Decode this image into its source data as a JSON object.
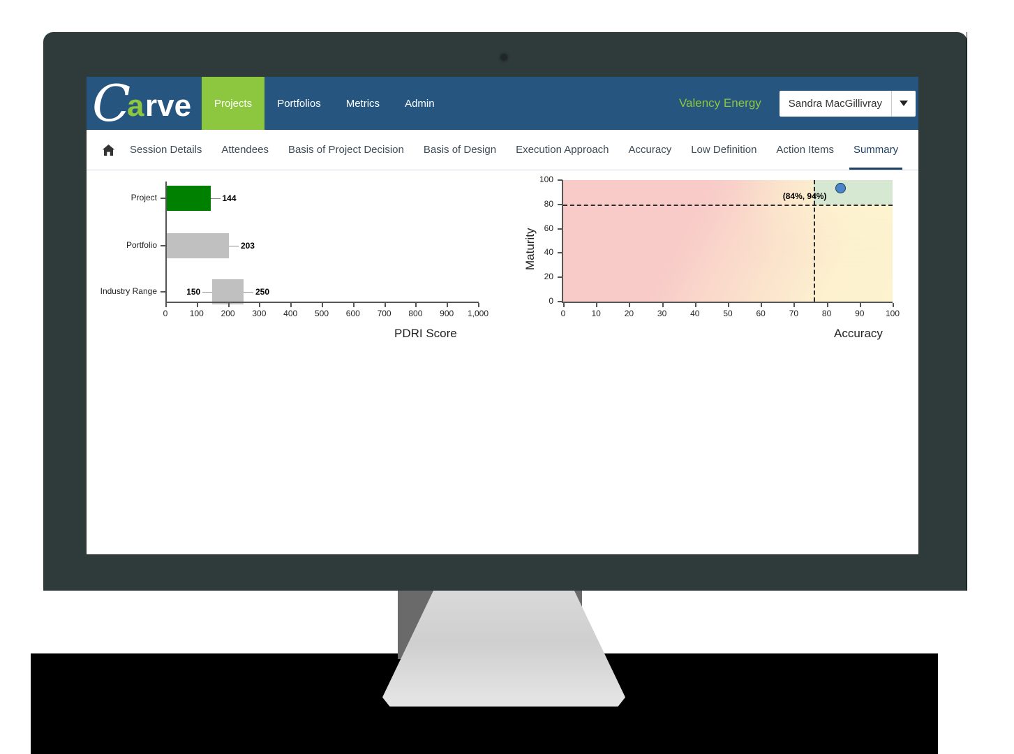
{
  "app": {
    "brand": {
      "letter_c": "C",
      "letter_a": "a",
      "rest": "rve",
      "full": "Carve"
    },
    "nav_items": [
      {
        "label": "Projects",
        "active": true
      },
      {
        "label": "Portfolios",
        "active": false
      },
      {
        "label": "Metrics",
        "active": false
      },
      {
        "label": "Admin",
        "active": false
      }
    ],
    "org_name": "Valency Energy",
    "user_name": "Sandra MacGillivray",
    "caret_icon": "chevron-down-icon",
    "home_icon": "home-icon",
    "colors": {
      "nav_blue": "#26567f",
      "accent_green": "#8dc63f",
      "bar_green": "#008000",
      "bar_gray": "#c0c0c0",
      "heat_red": "#f8cbc8",
      "heat_green": "#d6e8d1",
      "heat_yellow": "#fdf3cf",
      "point_blue": "#4a86c8",
      "bezel": "#2f3a3b"
    }
  },
  "tabs": [
    {
      "label": "Session Details",
      "active": false
    },
    {
      "label": "Attendees",
      "active": false
    },
    {
      "label": "Basis of Project Decision",
      "active": false
    },
    {
      "label": "Basis of Design",
      "active": false
    },
    {
      "label": "Execution Approach",
      "active": false
    },
    {
      "label": "Accuracy",
      "active": false
    },
    {
      "label": "Low Definition",
      "active": false
    },
    {
      "label": "Action Items",
      "active": false
    },
    {
      "label": "Summary",
      "active": true
    }
  ],
  "chart_data": [
    {
      "type": "bar",
      "orientation": "horizontal",
      "title": "",
      "xlabel": "PDRI Score",
      "ylabel": "",
      "xlim": [
        0,
        1000
      ],
      "grid": false,
      "categories": [
        "Project",
        "Portfolio",
        "Industry Range"
      ],
      "tick_labels": [
        "0",
        "100",
        "200",
        "300",
        "400",
        "500",
        "600",
        "700",
        "800",
        "900",
        "1,000"
      ],
      "ticks": [
        0,
        100,
        200,
        300,
        400,
        500,
        600,
        700,
        800,
        900,
        1000
      ],
      "bars": [
        {
          "category": "Project",
          "start": 0,
          "end": 144,
          "value": 144,
          "label": "144",
          "color": "#008000"
        },
        {
          "category": "Portfolio",
          "start": 0,
          "end": 203,
          "value": 203,
          "label": "203",
          "color": "#c0c0c0"
        },
        {
          "category": "Industry Range",
          "start": 150,
          "end": 250,
          "value": null,
          "label_low": "150",
          "label_high": "250",
          "color": "#c0c0c0"
        }
      ],
      "values": [
        144,
        203,
        null
      ]
    },
    {
      "type": "scatter",
      "title": "",
      "xlabel": "Accuracy",
      "ylabel": "Maturity",
      "xlim": [
        0,
        100
      ],
      "ylim": [
        0,
        100
      ],
      "grid": false,
      "x_ticks": [
        0,
        10,
        20,
        30,
        40,
        50,
        60,
        70,
        80,
        90,
        100
      ],
      "x_tick_labels": [
        "0",
        "10",
        "20",
        "30",
        "40",
        "50",
        "60",
        "70",
        "80",
        "90",
        "100"
      ],
      "y_ticks": [
        0,
        20,
        40,
        60,
        80,
        100
      ],
      "y_tick_labels": [
        "0",
        "20",
        "40",
        "60",
        "80",
        "100"
      ],
      "threshold_x": 76,
      "threshold_y": 80,
      "points": [
        {
          "x": 84,
          "y": 94,
          "label": "(84%, 94%)",
          "color": "#4a86c8"
        }
      ],
      "background": "heatmap red-to-green quadrant shading, green in top-right above thresholds"
    }
  ]
}
